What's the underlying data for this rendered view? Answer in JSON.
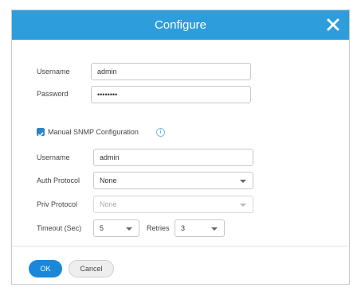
{
  "dialog": {
    "title": "Configure",
    "close_icon": "close-icon"
  },
  "credentials": {
    "username_label": "Username",
    "username_value": "admin",
    "password_label": "Password",
    "password_value": "••••••••"
  },
  "snmp": {
    "checkbox_label": "Manual SNMP Configuration",
    "checkbox_checked": true,
    "info_icon": "i",
    "username_label": "Username",
    "username_value": "admin",
    "auth_label": "Auth Protocol",
    "auth_value": "None",
    "priv_label": "Priv Protocol",
    "priv_value": "None",
    "timeout_label": "Timeout (Sec)",
    "timeout_value": "5",
    "retries_label": "Retries",
    "retries_value": "3"
  },
  "footer": {
    "ok_label": "OK",
    "cancel_label": "Cancel"
  },
  "colors": {
    "header": "#2e9ddb",
    "primary_button": "#1b87d8"
  }
}
